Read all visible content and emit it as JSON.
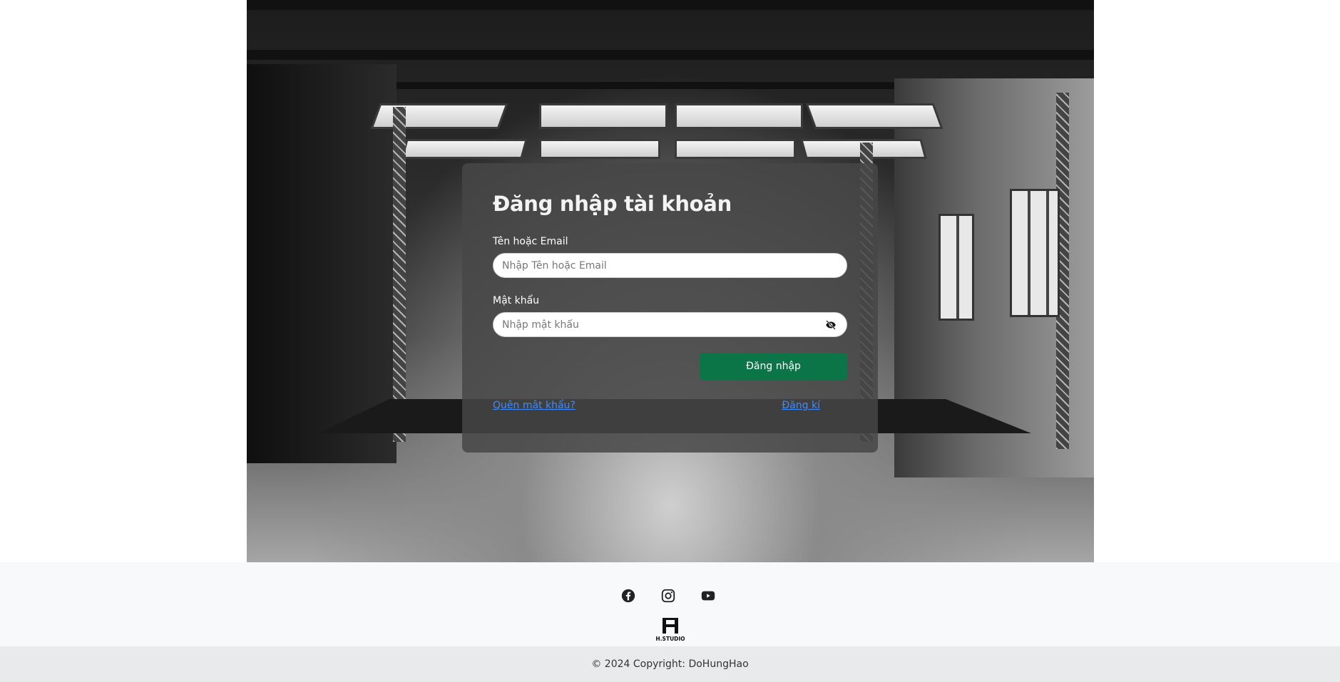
{
  "login": {
    "title": "Đăng nhập tài khoản",
    "username_label": "Tên hoặc Email",
    "username_placeholder": "Nhập Tên hoặc Email",
    "password_label": "Mật khẩu",
    "password_placeholder": "Nhập mật khẩu",
    "submit_label": "Đăng nhập",
    "forgot_label": "Quên mật khẩu?",
    "register_label": "Đăng kí",
    "password_toggle_icon": "eye-slash-icon"
  },
  "footer": {
    "social_icons": [
      "facebook-icon",
      "instagram-icon",
      "youtube-icon"
    ],
    "logo_text": "H.STUDIO",
    "copyright": "© 2024 Copyright: DoHungHao"
  },
  "colors": {
    "primary_button": "#0b7548",
    "link": "#3d8bfd",
    "footer_bg": "#f8f9fa",
    "copyright_bg": "#e9eaeb"
  }
}
